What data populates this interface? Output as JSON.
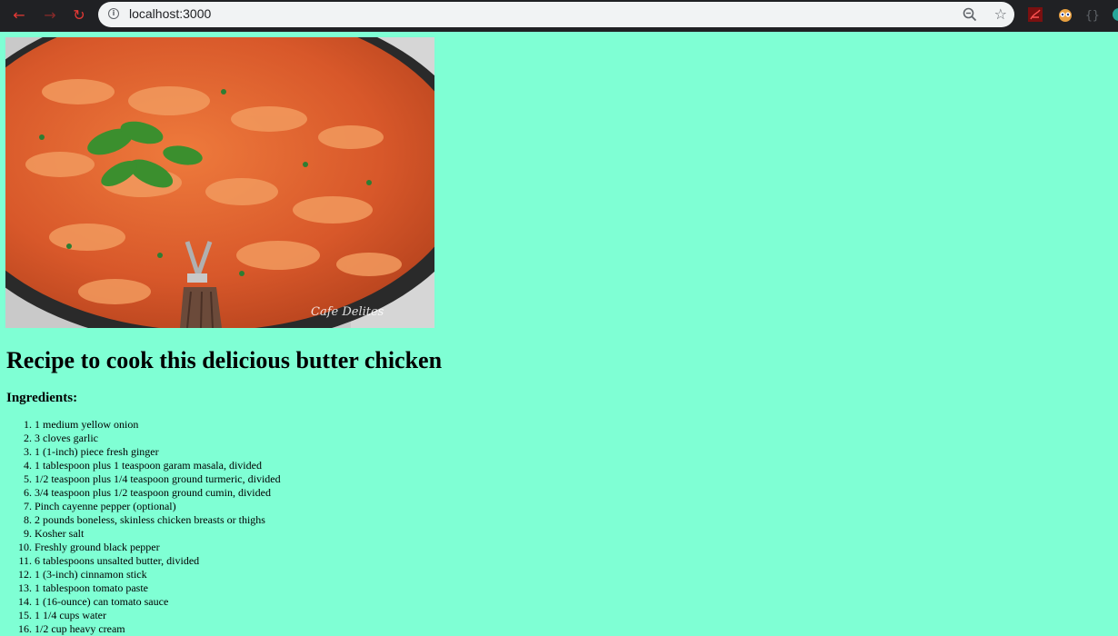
{
  "browser": {
    "url": "localhost:3000",
    "accent": "#e53935"
  },
  "page": {
    "background": "#7fffd4",
    "image_watermark": "Cafe Delites",
    "title": "Recipe to cook this delicious butter chicken",
    "ingredients_label": "Ingredients:",
    "ingredients": [
      "1 medium yellow onion",
      "3 cloves garlic",
      "1 (1-inch) piece fresh ginger",
      "1 tablespoon plus 1 teaspoon garam masala, divided",
      "1/2 teaspoon plus 1/4 teaspoon ground turmeric, divided",
      "3/4 teaspoon plus 1/2 teaspoon ground cumin, divided",
      "Pinch cayenne pepper (optional)",
      "2 pounds boneless, skinless chicken breasts or thighs",
      "Kosher salt",
      "Freshly ground black pepper",
      "6 tablespoons unsalted butter, divided",
      "1 (3-inch) cinnamon stick",
      "1 tablespoon tomato paste",
      "1 (16-ounce) can tomato sauce",
      "1 1/4 cups water",
      "1/2 cup heavy cream"
    ]
  }
}
